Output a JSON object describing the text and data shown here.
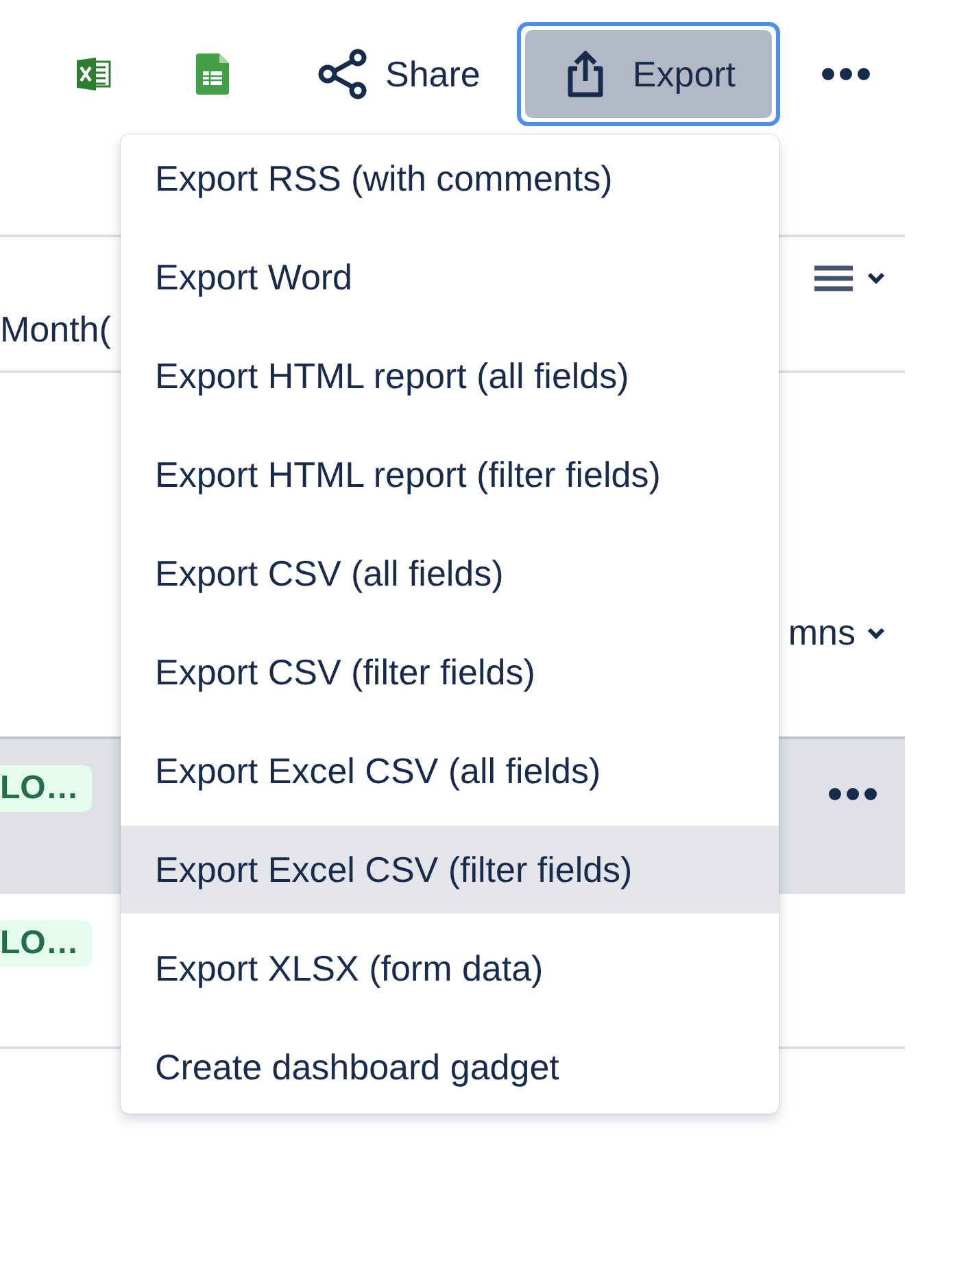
{
  "toolbar": {
    "share": {
      "label": "Share"
    },
    "export": {
      "label": "Export",
      "focused": true
    }
  },
  "table": {
    "header_cell": "Month(",
    "columns_button": {
      "label": "mns"
    },
    "rows": [
      {
        "tag": "LO…",
        "selected": true
      },
      {
        "tag": "LO…",
        "selected": false
      }
    ]
  },
  "export_menu": {
    "items": [
      {
        "label": "Export RSS (with comments)",
        "selected": false
      },
      {
        "label": "Export Word",
        "selected": false
      },
      {
        "label": "Export HTML report (all fields)",
        "selected": false
      },
      {
        "label": "Export HTML report (filter fields)",
        "selected": false
      },
      {
        "label": "Export CSV (all fields)",
        "selected": false
      },
      {
        "label": "Export CSV (filter fields)",
        "selected": false
      },
      {
        "label": "Export Excel CSV (all fields)",
        "selected": false
      },
      {
        "label": "Export Excel CSV (filter fields)",
        "selected": true
      },
      {
        "label": "Export XLSX (form data)",
        "selected": false
      },
      {
        "label": "Create dashboard gadget",
        "selected": false
      }
    ]
  }
}
